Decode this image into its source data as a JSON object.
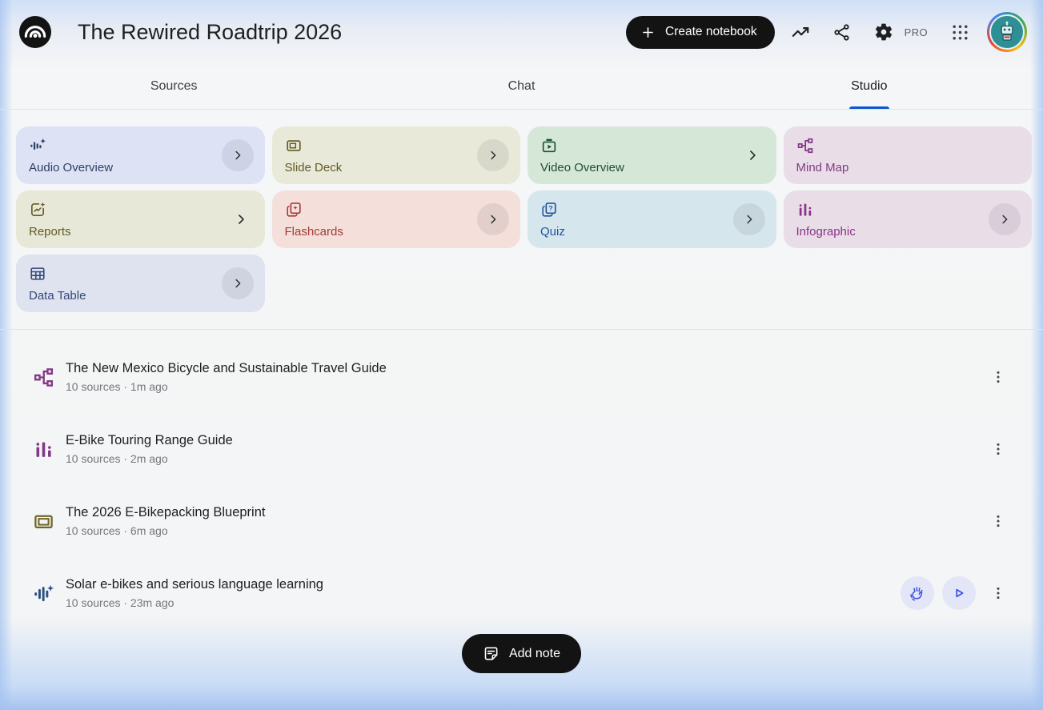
{
  "colors": {
    "accent_blue": "#0b57d0",
    "pill_black": "#131314",
    "page_bg": "#f5f6f7",
    "edge_glow_blue": "#a5c3ef",
    "divider": "#e1e3e4",
    "title_text": "#1f1f1f",
    "meta_text": "#73777b",
    "audio_action_accent": "#3f51e3"
  },
  "header": {
    "title": "The Rewired Roadtrip 2026",
    "create_button_label": "Create notebook",
    "pro_label": "PRO"
  },
  "icons": {
    "logo": "notebooklm-arcs-logo",
    "plus": "+",
    "analytics": "trending-up-arrow",
    "share": "share-nodes",
    "settings": "gear",
    "apps": "3x3-dot-grid",
    "chevron": "›",
    "more_menu": "⋮",
    "interactive_mode": "waving-hand",
    "play": "▶",
    "add_note": "note-with-folded-corner"
  },
  "tabs": [
    {
      "label": "Sources",
      "active": false
    },
    {
      "label": "Chat",
      "active": false
    },
    {
      "label": "Studio",
      "active": true
    }
  ],
  "studio": {
    "tools": [
      {
        "label": "Audio Overview",
        "icon": "audio-waveform-sparkle-icon",
        "bg": "#dde2f5",
        "fg": "#2e3f66",
        "chevron": "circle"
      },
      {
        "label": "Slide Deck",
        "icon": "slide-deck-icon",
        "bg": "#e9e9d9",
        "fg": "#605b20",
        "chevron": "circle"
      },
      {
        "label": "Video Overview",
        "icon": "video-overview-icon",
        "bg": "#d5e8d8",
        "fg": "#1f4d33",
        "chevron": "plain"
      },
      {
        "label": "Mind Map",
        "icon": "mind-map-icon",
        "bg": "#e9dde8",
        "fg": "#823a85",
        "chevron": "none"
      },
      {
        "label": "Reports",
        "icon": "report-sparkle-icon",
        "bg": "#e8e8d8",
        "fg": "#605b20",
        "chevron": "plain"
      },
      {
        "label": "Flashcards",
        "icon": "flashcards-icon",
        "bg": "#f4dfdb",
        "fg": "#a33b32",
        "chevron": "circle"
      },
      {
        "label": "Quiz",
        "icon": "quiz-icon",
        "bg": "#d5e7ed",
        "fg": "#23519f",
        "chevron": "circle"
      },
      {
        "label": "Infographic",
        "icon": "infographic-icon",
        "bg": "#e9dde8",
        "fg": "#8a3387",
        "chevron": "circle"
      },
      {
        "label": "Data Table",
        "icon": "data-table-icon",
        "bg": "#dfe3f0",
        "fg": "#33487a",
        "chevron": "circle"
      }
    ]
  },
  "artifacts": [
    {
      "icon": "mind-map-icon",
      "icon_color": "#833a86",
      "title": "The New Mexico Bicycle and Sustainable Travel Guide",
      "meta": "10 sources · 1m ago"
    },
    {
      "icon": "infographic-icon",
      "icon_color": "#833a86",
      "title": "E-Bike Touring Range Guide",
      "meta": "10 sources · 2m ago"
    },
    {
      "icon": "slide-deck-icon",
      "icon_color": "#6e6526",
      "title": "The 2026 E-Bikepacking Blueprint",
      "meta": "10 sources · 6m ago"
    },
    {
      "icon": "audio-waveform-sparkle-icon",
      "icon_color": "#2d4f82",
      "title": "Solar e-bikes and serious language learning",
      "meta": "10 sources · 23m ago",
      "has_audio_controls": true
    }
  ],
  "footer": {
    "add_note_label": "Add note"
  }
}
